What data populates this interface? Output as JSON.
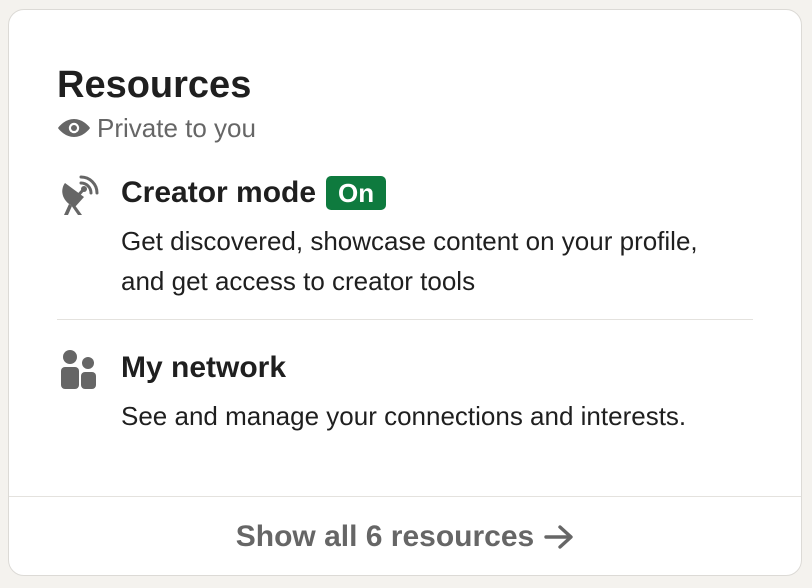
{
  "card": {
    "title": "Resources",
    "privacy_label": "Private to you",
    "privacy_icon": "eye-icon"
  },
  "resources": [
    {
      "title": "Creator mode",
      "badge": "On",
      "badge_color": "#0e7a3e",
      "description": "Get discovered, showcase content on your profile, and get access to creator tools",
      "icon": "satellite-dish-icon"
    },
    {
      "title": "My network",
      "description": "See and manage your connections and interests.",
      "icon": "people-icon"
    }
  ],
  "footer": {
    "label": "Show all 6 resources",
    "icon": "arrow-right-icon"
  },
  "colors": {
    "text_primary": "#1f1f1f",
    "text_secondary": "#666666",
    "badge_green": "#0e7a3e"
  }
}
